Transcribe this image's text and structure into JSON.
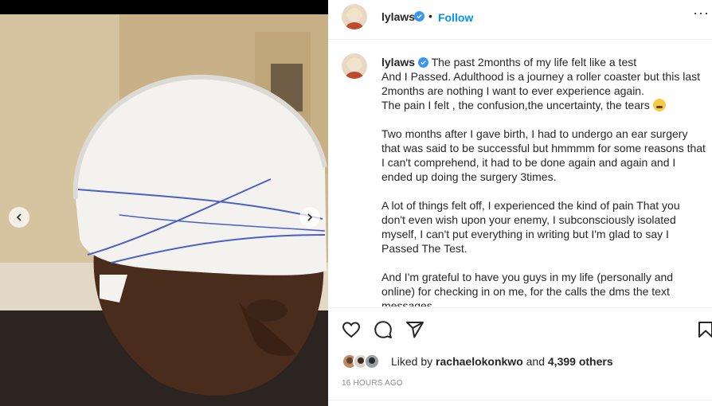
{
  "media": {
    "image_subject": "",
    "prev_arrow": "chevron-left-icon",
    "next_arrow": "chevron-right-icon"
  },
  "header": {
    "username": "lylaws",
    "verified": "verified-badge-icon",
    "separator": "•",
    "follow_label": "Follow",
    "more_label": "···"
  },
  "caption": {
    "username": "lylaws",
    "paragraphs": [
      "The past 2months of my life felt like a test",
      "And I Passed. Adulthood is a journey a roller coaster but this last 2months are nothing I want to ever experience again.",
      "The pain I felt , the confusion,the uncertainty, the tears",
      "Two months after I gave birth, I had to undergo an ear surgery that was said to be successful but hmmmm for some reasons that I can't comprehend, it had to be done again and again and I ended up doing the surgery 3times.",
      "A lot of things felt off, I experienced the kind of pain That you don't even wish upon your enemy, I subconsciously isolated myself, I can't put everything in writing but I'm glad to say I Passed The Test.",
      "And I'm grateful to have you guys in my life (personally and online) for checking in on me, for the calls the dms the text messages"
    ]
  },
  "actions": {
    "like": "heart-icon",
    "comment": "comment-icon",
    "share": "paper-plane-icon",
    "save": "bookmark-icon"
  },
  "likes": {
    "prefix": "Liked by",
    "first_user": "rachaelokonkwo",
    "conjunction": "and",
    "others": "4,399 others"
  },
  "timestamp": "16 HOURS AGO",
  "colors": {
    "accent": "#0095f6",
    "text": "#262626",
    "muted": "#8e8e8e",
    "verified": "#3897f0",
    "border": "#efefef"
  }
}
